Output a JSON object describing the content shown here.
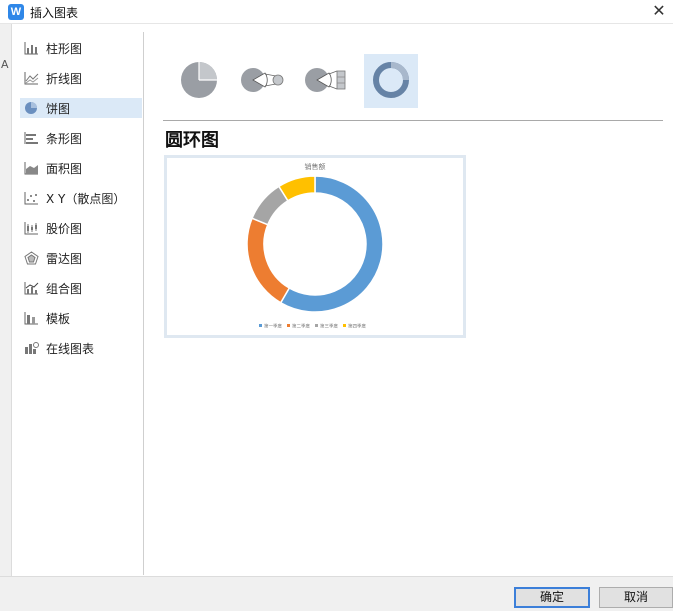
{
  "window": {
    "title": "插入图表",
    "app_icon_letter": "W",
    "close_glyph": "✕"
  },
  "left_strip": {
    "mark": "A"
  },
  "sidebar": {
    "items": [
      {
        "label": "柱形图",
        "icon": "bar-chart-icon"
      },
      {
        "label": "折线图",
        "icon": "line-chart-icon"
      },
      {
        "label": "饼图",
        "icon": "pie-chart-icon",
        "selected": true
      },
      {
        "label": "条形图",
        "icon": "horizontal-bar-icon"
      },
      {
        "label": "面积图",
        "icon": "area-chart-icon"
      },
      {
        "label": "X Y（散点图）",
        "icon": "scatter-chart-icon"
      },
      {
        "label": "股价图",
        "icon": "stock-chart-icon"
      },
      {
        "label": "雷达图",
        "icon": "radar-chart-icon"
      },
      {
        "label": "组合图",
        "icon": "combo-chart-icon"
      },
      {
        "label": "模板",
        "icon": "template-icon"
      },
      {
        "label": "在线图表",
        "icon": "online-chart-icon"
      }
    ]
  },
  "subtypes": [
    {
      "icon": "pie-subtype-icon"
    },
    {
      "icon": "pie-of-pie-subtype-icon"
    },
    {
      "icon": "bar-of-pie-subtype-icon"
    },
    {
      "icon": "doughnut-subtype-icon",
      "selected": true
    }
  ],
  "selected_chart": {
    "name": "圆环图"
  },
  "colors": {
    "accent": "#3c7fd9",
    "selected_bg": "#dbe9f7",
    "blue": "#5b9bd5",
    "orange": "#ed7d31",
    "gray": "#a5a5a5",
    "yellow": "#ffc000"
  },
  "chart_data": {
    "type": "pie",
    "title": "销售额",
    "series": [
      {
        "name": "销售额",
        "values": [
          59,
          23,
          10,
          9
        ]
      }
    ],
    "categories": [
      "第一季度",
      "第二季度",
      "第三季度",
      "第四季度"
    ],
    "legend": "bottom",
    "doughnut": true
  },
  "buttons": {
    "ok": "确定",
    "cancel": "取消"
  }
}
